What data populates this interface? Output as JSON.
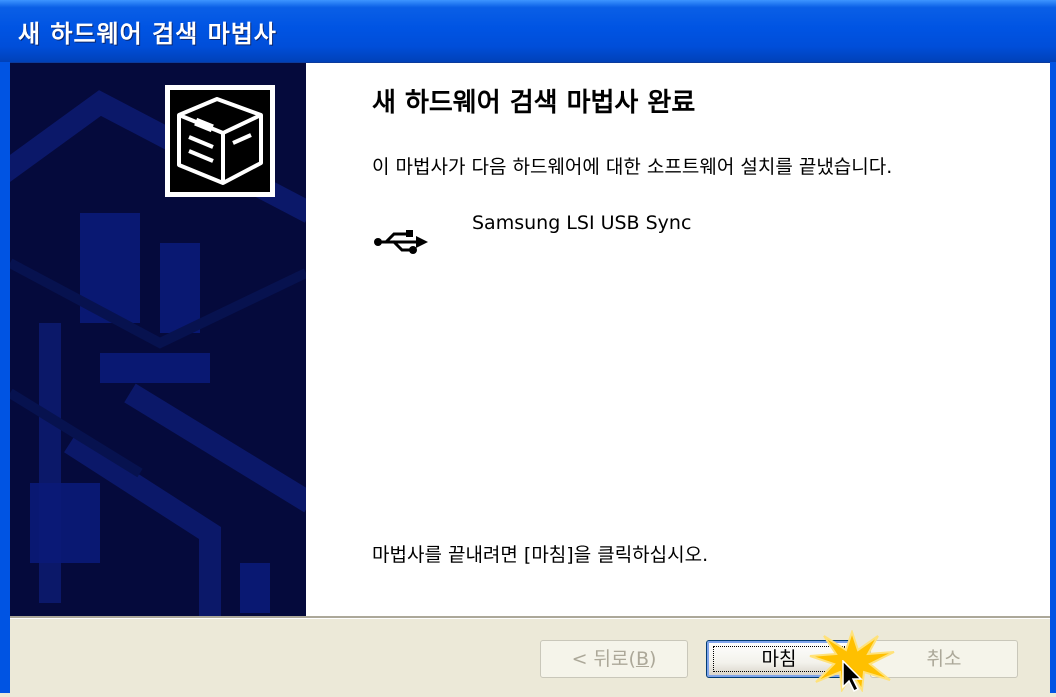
{
  "window": {
    "title": "새 하드웨어 검색 마법사"
  },
  "main": {
    "heading": "새 하드웨어 검색 마법사 완료",
    "description": "이 마법사가 다음 하드웨어에 대한 소프트웨어 설치를 끝냈습니다.",
    "device": {
      "icon": "usb-icon",
      "name": "Samsung LSI USB Sync"
    },
    "finish_hint": "마법사를 끝내려면 [마침]을 클릭하십시오."
  },
  "buttons": {
    "back": {
      "prefix": "< 뒤로(",
      "mnemonic": "B",
      "suffix": ")",
      "enabled": false
    },
    "finish": {
      "label": "마침",
      "enabled": true
    },
    "cancel": {
      "label": "취소",
      "enabled": false
    }
  },
  "colors": {
    "title_bar": "#0054e3",
    "side_panel": "#050a3c",
    "dialog_bg": "#ece9d8",
    "highlight_burst": "#ffc000"
  }
}
